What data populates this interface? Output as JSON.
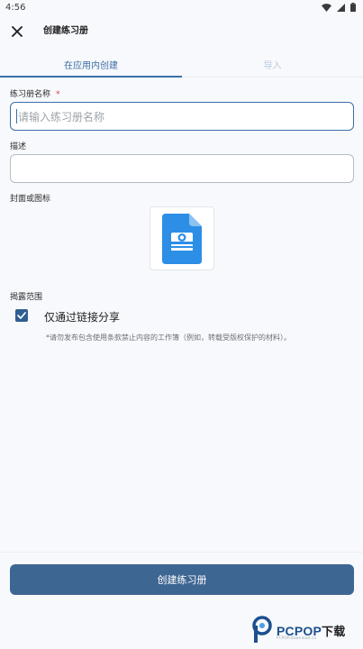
{
  "status_bar": {
    "time": "4:56"
  },
  "header": {
    "title": "创建练习册"
  },
  "tabs": [
    {
      "label": "在应用内创建",
      "active": true
    },
    {
      "label": "导入",
      "active": false
    }
  ],
  "form": {
    "name": {
      "label": "练习册名称",
      "required_mark": "*",
      "placeholder": "请输入练习册名称",
      "value": ""
    },
    "description": {
      "label": "描述",
      "value": ""
    },
    "cover": {
      "label": "封面或图标",
      "icon": "document-image-icon"
    },
    "visibility": {
      "label": "揭露范围",
      "option_label": "仅通过链接分享",
      "checked": true,
      "note": "*请勿发布包含使用条款禁止内容的工作簿（例如，转载受版权保护的材料）。"
    }
  },
  "primary_button": {
    "label": "创建练习册"
  },
  "watermark": {
    "brand": "PCPOP",
    "suffix": "下载",
    "sub": "PCPOP.download.cn"
  },
  "colors": {
    "accent": "#3d6fa8",
    "button": "#3e6693",
    "required": "#d9413e",
    "icon_blue": "#2d8ee6"
  }
}
